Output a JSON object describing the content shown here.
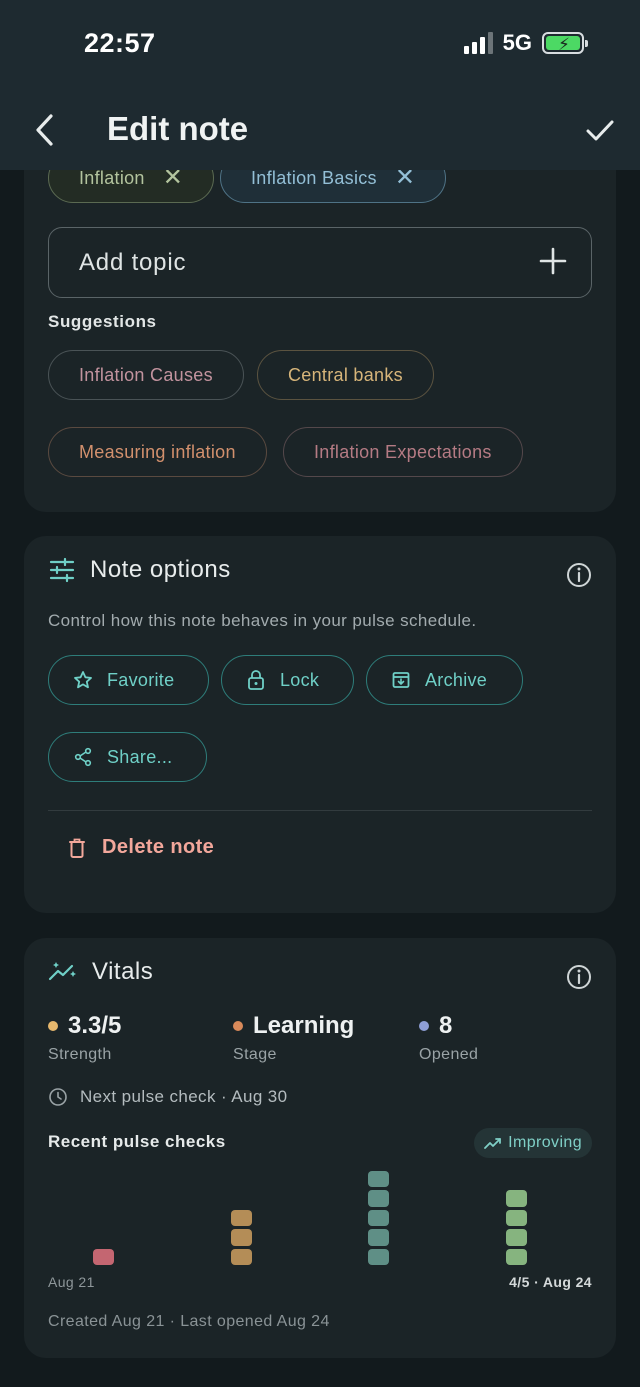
{
  "status_bar": {
    "time": "22:57",
    "network": "5G"
  },
  "header": {
    "title": "Edit note"
  },
  "topics": {
    "selected": [
      {
        "label": "Inflation"
      },
      {
        "label": "Inflation Basics"
      }
    ],
    "add_placeholder": "Add topic",
    "suggestions_label": "Suggestions",
    "suggestions": [
      "Inflation Causes",
      "Central banks",
      "Measuring inflation",
      "Inflation Expectations"
    ]
  },
  "note_options": {
    "title": "Note options",
    "description": "Control how this note behaves in your pulse schedule.",
    "buttons": {
      "favorite": "Favorite",
      "lock": "Lock",
      "archive": "Archive",
      "share": "Share..."
    },
    "delete": "Delete note"
  },
  "vitals": {
    "title": "Vitals",
    "stats": [
      {
        "value": "3.3/5",
        "label": "Strength",
        "color": "#e7b86d"
      },
      {
        "value": "Learning",
        "label": "Stage",
        "color": "#d98a5a"
      },
      {
        "value": "8",
        "label": "Opened",
        "color": "#8f9fd6"
      }
    ],
    "next_pulse": "Next pulse check · Aug 30",
    "recent_label": "Recent pulse checks",
    "trend": "Improving",
    "pulse_checks": [
      {
        "score": 1,
        "color": "#c46671"
      },
      {
        "score": 3,
        "color": "#b48d57"
      },
      {
        "score": 5,
        "color": "#5f8f86"
      },
      {
        "score": 4,
        "color": "#86b47f"
      }
    ],
    "axis_start": "Aug 21",
    "axis_end": "4/5 · Aug 24",
    "footer": "Created Aug 21 · Last opened Aug 24"
  }
}
